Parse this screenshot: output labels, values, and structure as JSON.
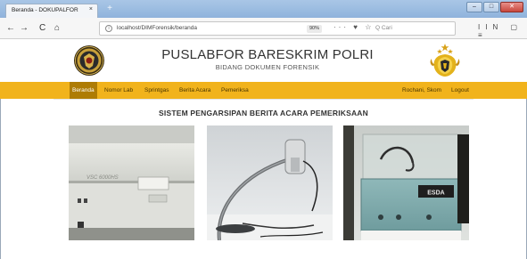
{
  "browser": {
    "tab_title": "Beranda - DOKUPALFOR",
    "tab_close": "×",
    "new_tab": "+",
    "url": "localhost/DIMForensik/beranda",
    "zoom": "90%",
    "url_icons": "··· ♥ ☆",
    "search_placeholder": "Q  Cari",
    "toolbar_right_icons": "IIN ▢ ≡",
    "nav_back": "←",
    "nav_forward": "→",
    "nav_reload": "C",
    "nav_home": "⌂",
    "window_minimize": "–",
    "window_maximize": "□",
    "window_close": "✕"
  },
  "header": {
    "title": "PUSLABFOR BARESKRIM POLRI",
    "subtitle": "BIDANG DOKUMEN FORENSIK"
  },
  "menu": {
    "items": [
      {
        "label": "Beranda",
        "active": true
      },
      {
        "label": "Nomor Lab",
        "active": false
      },
      {
        "label": "Sprintgas",
        "active": false
      },
      {
        "label": "Berita Acara",
        "active": false
      },
      {
        "label": "Pemeriksa",
        "active": false
      }
    ],
    "user": "Rochani, Skom",
    "logout": "Logout"
  },
  "main": {
    "section_title": "SISTEM PENGARSIPAN BERITA ACARA PEMERIKSAAN",
    "photos": [
      {
        "label": "VSC 6000HS"
      },
      {
        "label": ""
      },
      {
        "label": "ESDA"
      }
    ]
  },
  "colors": {
    "menu_bar": "#f1b31c",
    "menu_active": "#ae7c05",
    "title_text": "#333333"
  }
}
